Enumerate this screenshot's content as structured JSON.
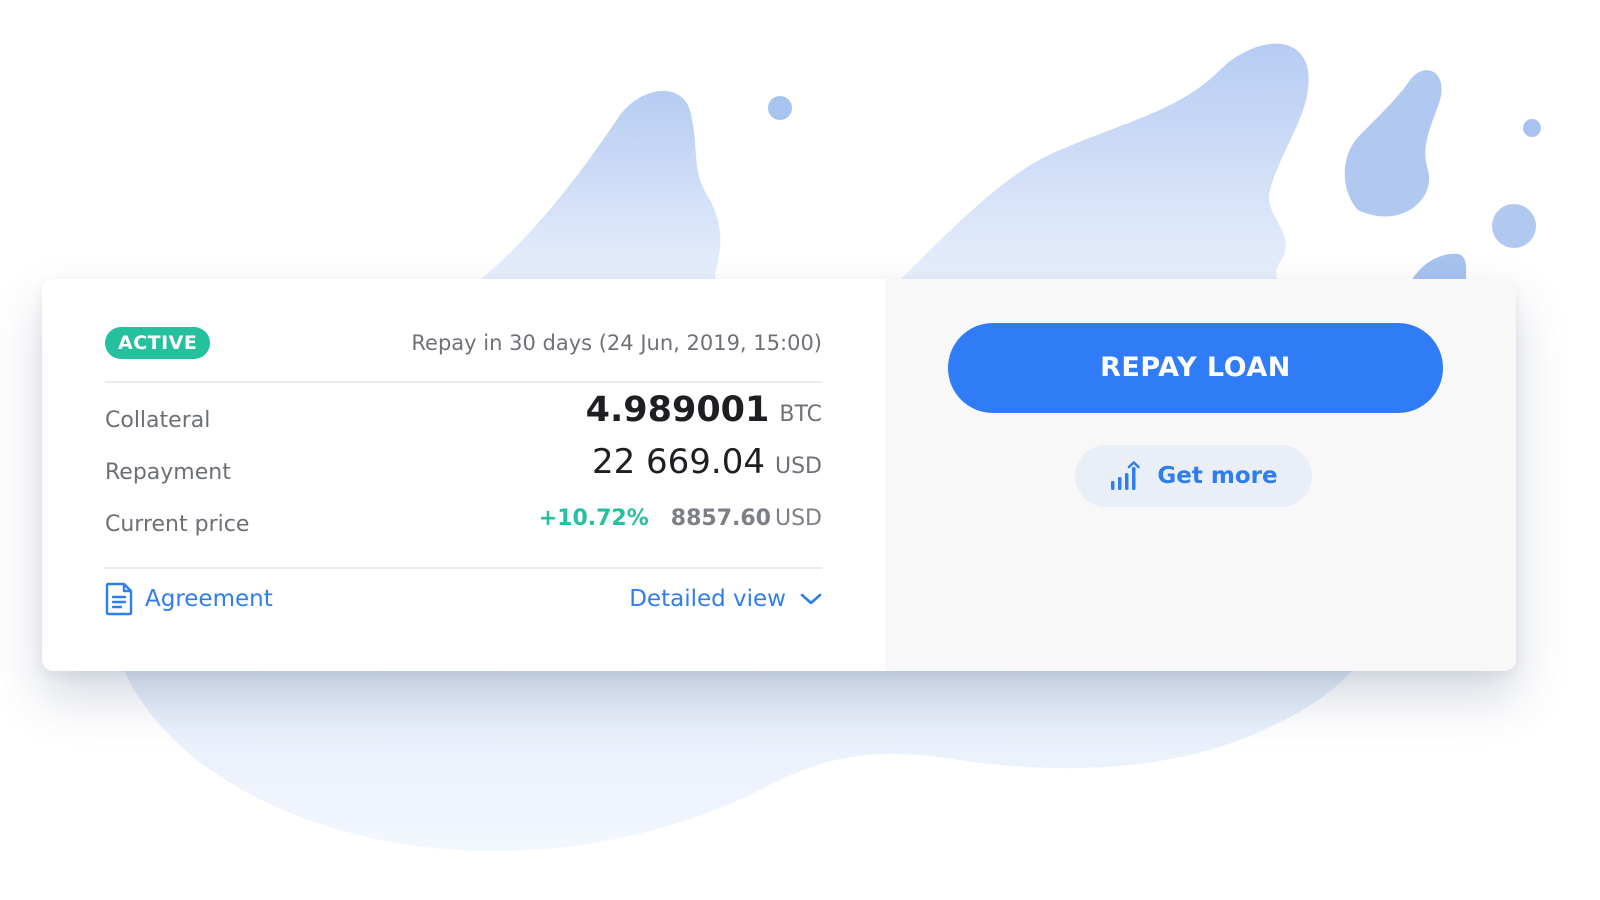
{
  "loan": {
    "status_badge": "ACTIVE",
    "repay_in": "Repay in 30 days (24 Jun, 2019, 15:00)",
    "collateral": {
      "label": "Collateral",
      "amount": "4.989001",
      "currency": "BTC"
    },
    "repayment": {
      "label": "Repayment",
      "amount": "22 669.04",
      "currency": "USD"
    },
    "current_price": {
      "label": "Current price",
      "change": "+10.72%",
      "amount": "8857.60",
      "currency": "USD"
    },
    "agreement_link": "Agreement",
    "detailed_view_link": "Detailed view"
  },
  "actions": {
    "repay_label": "REPAY LOAN",
    "get_more_label": "Get more"
  },
  "icons": {
    "agreement": "document-icon",
    "detailed_view": "chevron-down-icon",
    "get_more": "bar-chart-up-icon"
  },
  "colors": {
    "accent": "#2f7cf6",
    "active_badge": "#25c09e",
    "positive_change": "#25c09e"
  }
}
